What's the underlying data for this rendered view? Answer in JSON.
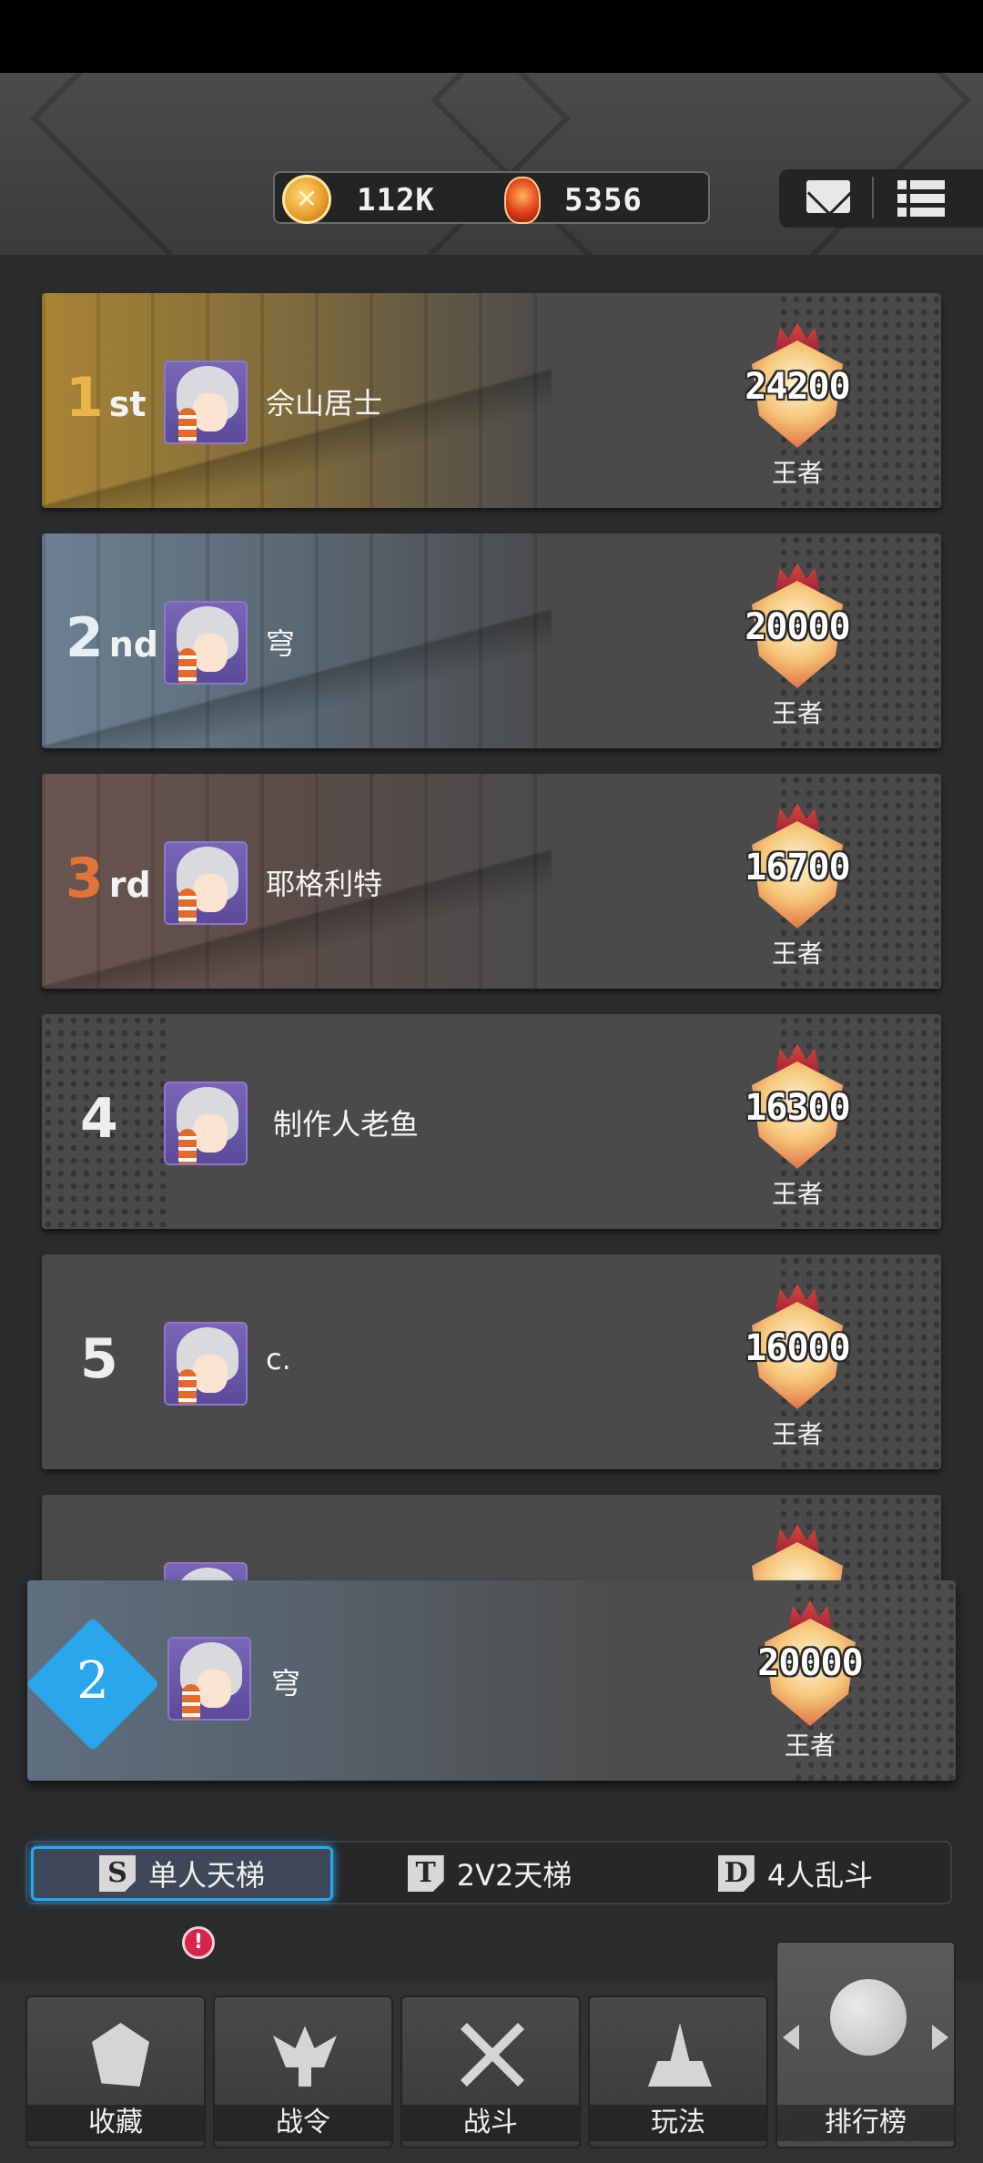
{
  "currency": {
    "coins": "112K",
    "gems": "5356"
  },
  "header_icons": [
    "mail-icon",
    "list-icon"
  ],
  "ranking": [
    {
      "rank": "1",
      "suffix": "st",
      "name": "佘山居士",
      "score": "24200",
      "tier": "王者"
    },
    {
      "rank": "2",
      "suffix": "nd",
      "name": "穹",
      "score": "20000",
      "tier": "王者"
    },
    {
      "rank": "3",
      "suffix": "rd",
      "name": "耶格利特",
      "score": "16700",
      "tier": "王者"
    },
    {
      "rank": "4",
      "suffix": "",
      "name": "制作人老鱼",
      "score": "16300",
      "tier": "王者"
    },
    {
      "rank": "5",
      "suffix": "",
      "name": "c.",
      "score": "16000",
      "tier": "王者"
    }
  ],
  "self": {
    "rank": "2",
    "name": "穹",
    "score": "20000",
    "tier": "王者"
  },
  "mode_tabs": [
    {
      "icon": "S",
      "label": "单人天梯",
      "active": true
    },
    {
      "icon": "T",
      "label": "2V2天梯",
      "active": false
    },
    {
      "icon": "D",
      "label": "4人乱斗",
      "active": false
    }
  ],
  "nav": [
    {
      "label": "收藏",
      "icon": "cards-icon"
    },
    {
      "label": "战令",
      "icon": "wings-icon"
    },
    {
      "label": "战斗",
      "icon": "swords-icon"
    },
    {
      "label": "玩法",
      "icon": "map-icon"
    },
    {
      "label": "排行榜",
      "icon": "ranking-icon"
    }
  ],
  "notification_badge": "!"
}
